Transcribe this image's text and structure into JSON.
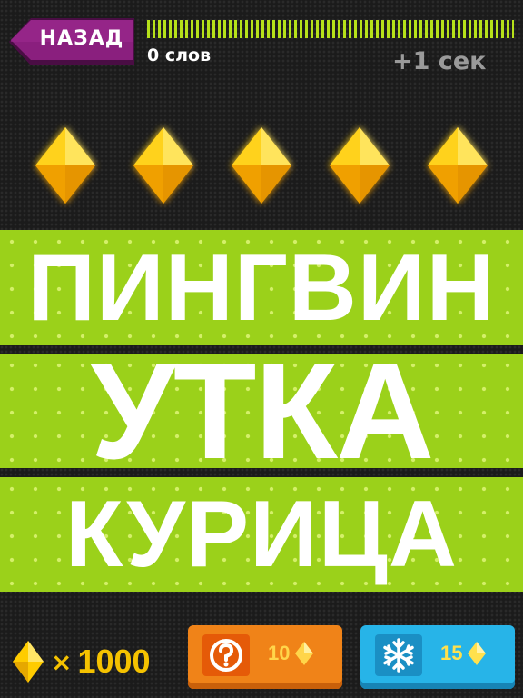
{
  "header": {
    "back_label": "НАЗАД",
    "word_count": "0 слов",
    "time_bonus": "+1 сек"
  },
  "gems": {
    "count": 5
  },
  "words": [
    "ПИНГВИН",
    "УТКА",
    "КУРИЦА"
  ],
  "footer": {
    "balance_multiplier": "×",
    "balance": "1000",
    "hint_price": "10",
    "freeze_price": "15"
  },
  "colors": {
    "accent_green": "#9bd11a",
    "gem_yellow": "#ffcc00",
    "hint_orange": "#f08318",
    "freeze_blue": "#27b4e8",
    "back_purple": "#7a1a6e"
  }
}
